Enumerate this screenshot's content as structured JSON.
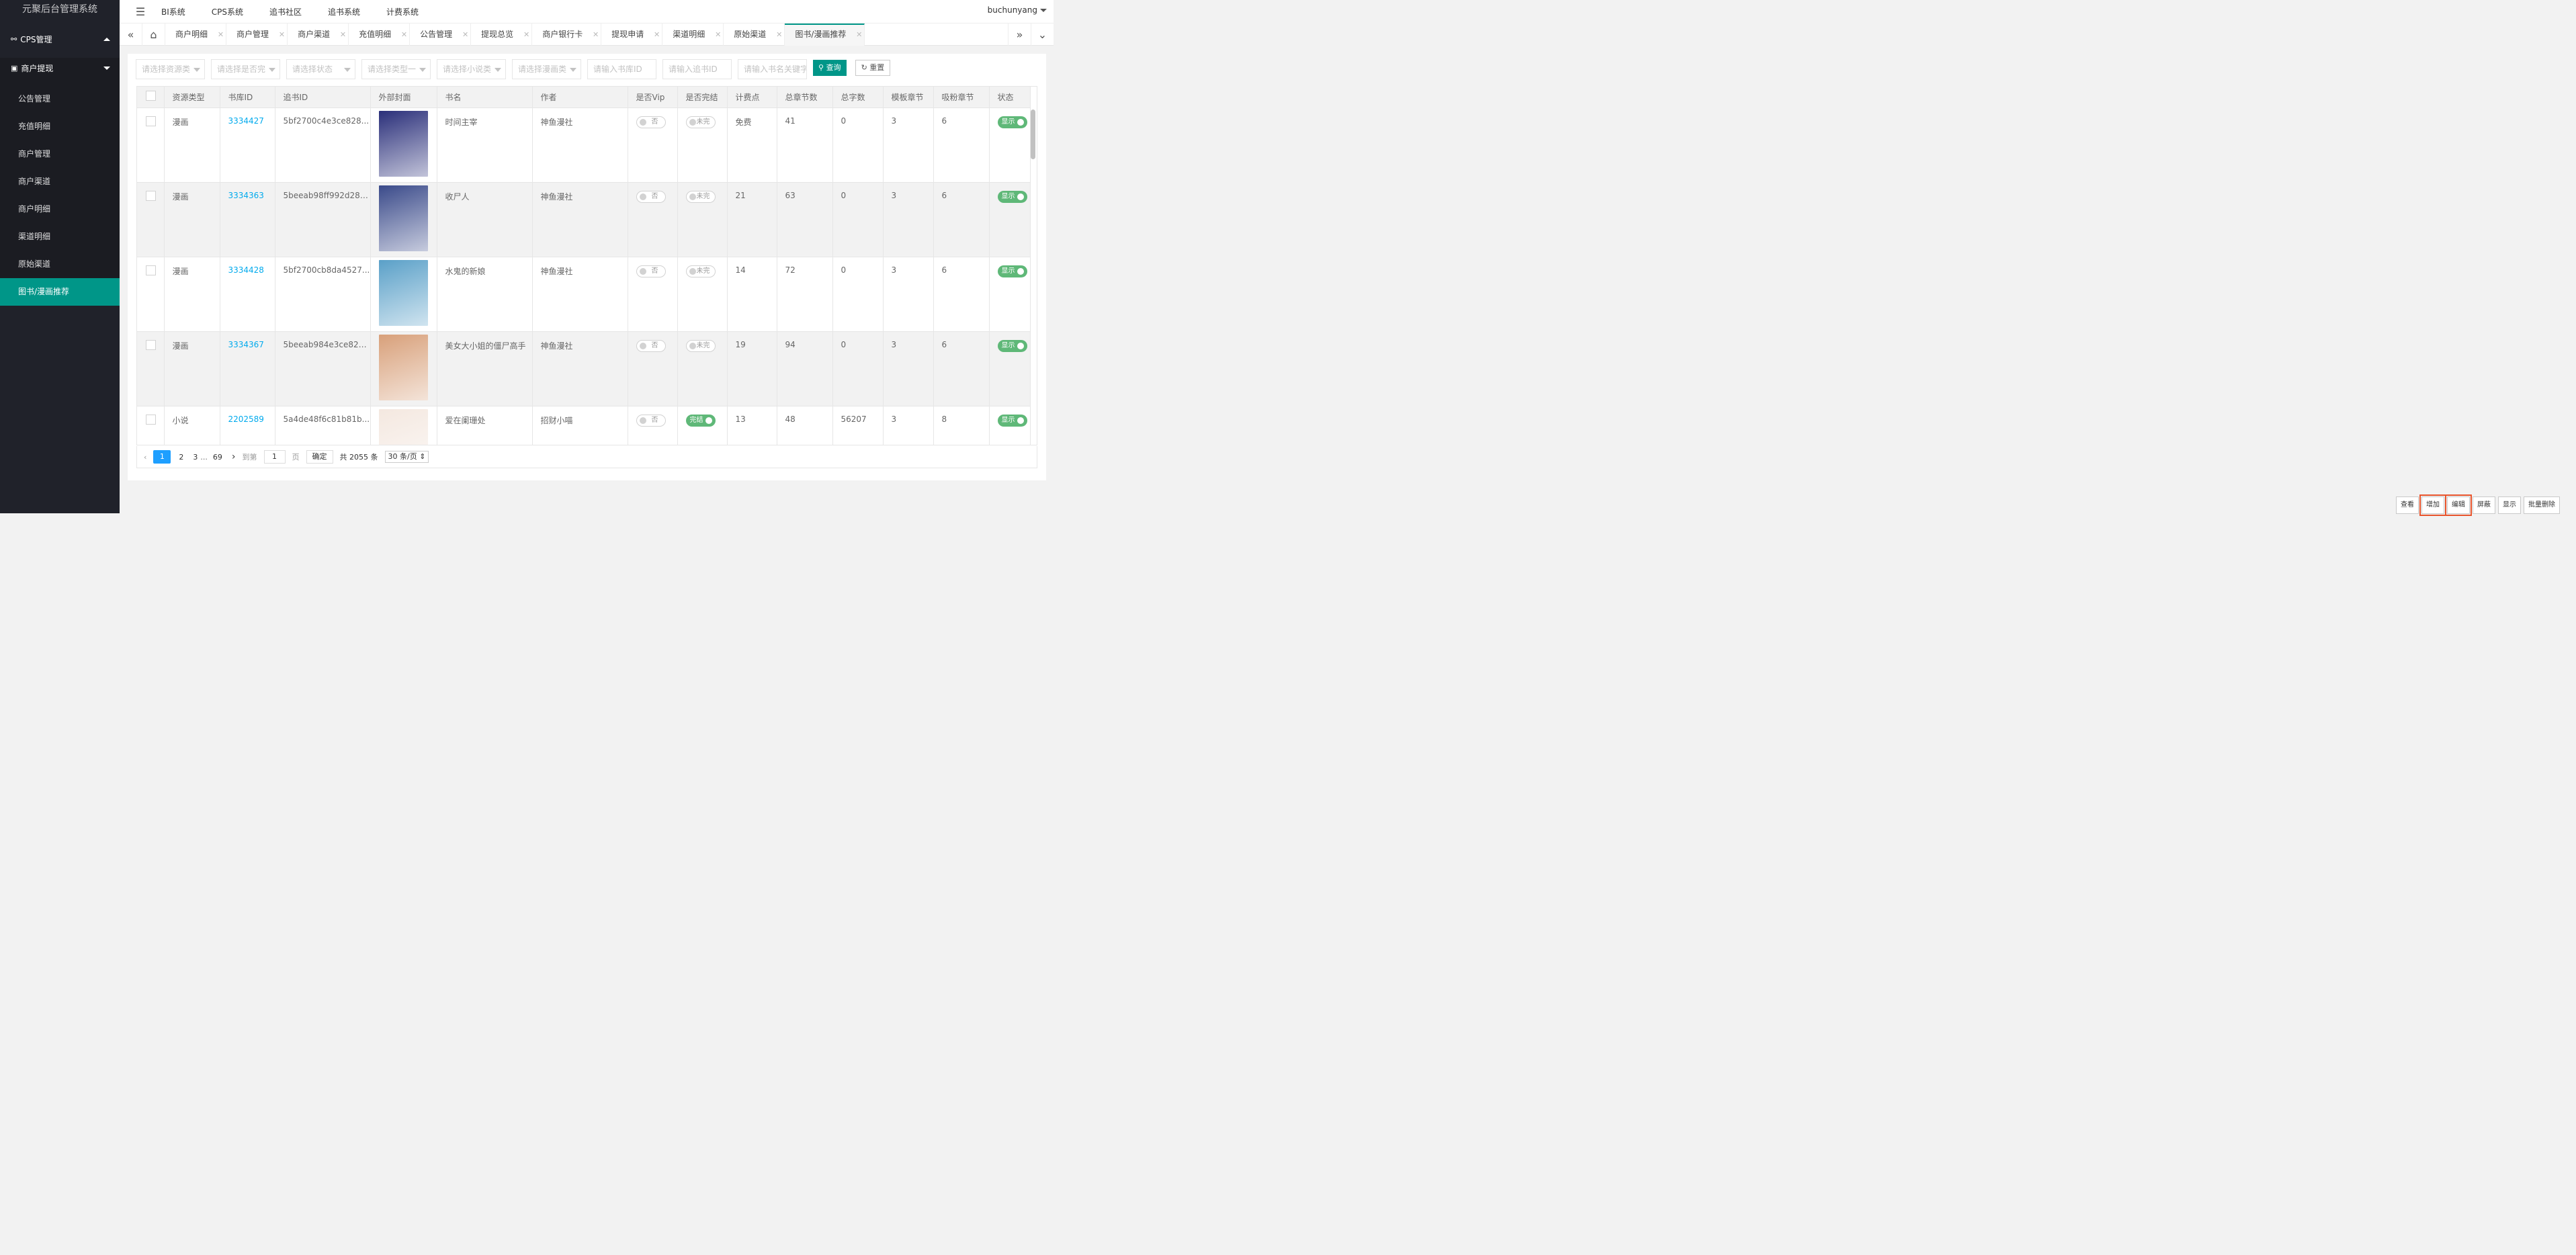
{
  "app_title": "元聚后台管理系统",
  "sidebar": {
    "group": "CPS管理",
    "sub": "商户提现",
    "items": [
      "公告管理",
      "充值明细",
      "商户管理",
      "商户渠道",
      "商户明细",
      "渠道明细",
      "原始渠道",
      "图书/漫画推荐"
    ]
  },
  "topnav": [
    "BI系统",
    "CPS系统",
    "追书社区",
    "追书系统",
    "计费系统"
  ],
  "user": "buchunyang",
  "tabs": [
    "商户明细",
    "商户管理",
    "商户渠道",
    "充值明细",
    "公告管理",
    "提现总览",
    "商户银行卡",
    "提现申请",
    "渠道明细",
    "原始渠道",
    "图书/漫画推荐"
  ],
  "filters": {
    "selects": [
      "请选择资源类",
      "请选择是否完",
      "请选择状态",
      "请选择类型一",
      "请选择小说类",
      "请选择漫画类"
    ],
    "inputs": [
      "请输入书库ID",
      "请输入追书ID",
      "请输入书名关键字"
    ],
    "query": "查询",
    "reset": "重置"
  },
  "columns": [
    "资源类型",
    "书库ID",
    "追书ID",
    "外部封面",
    "书名",
    "作者",
    "是否Vip",
    "是否完结",
    "计费点",
    "总章节数",
    "总字数",
    "模板章节",
    "吸粉章节",
    "状态"
  ],
  "rows": [
    {
      "type": "漫画",
      "lib_id": "3334427",
      "zs_id": "5bf2700c4e3ce828...",
      "title": "时间主宰",
      "author": "神鱼漫社",
      "vip": "否",
      "done": "未完",
      "done_on": false,
      "fee": "免费",
      "chapters": "41",
      "words": "0",
      "tpl": "3",
      "fans": "6",
      "status": "显示"
    },
    {
      "type": "漫画",
      "lib_id": "3334363",
      "zs_id": "5beeab98ff992d283...",
      "title": "收尸人",
      "author": "神鱼漫社",
      "vip": "否",
      "done": "未完",
      "done_on": false,
      "fee": "21",
      "chapters": "63",
      "words": "0",
      "tpl": "3",
      "fans": "6",
      "status": "显示"
    },
    {
      "type": "漫画",
      "lib_id": "3334428",
      "zs_id": "5bf2700cb8da4527...",
      "title": "水鬼的新娘",
      "author": "神鱼漫社",
      "vip": "否",
      "done": "未完",
      "done_on": false,
      "fee": "14",
      "chapters": "72",
      "words": "0",
      "tpl": "3",
      "fans": "6",
      "status": "显示"
    },
    {
      "type": "漫画",
      "lib_id": "3334367",
      "zs_id": "5beeab984e3ce828...",
      "title": "美女大小姐的僵尸高手",
      "author": "神鱼漫社",
      "vip": "否",
      "done": "未完",
      "done_on": false,
      "fee": "19",
      "chapters": "94",
      "words": "0",
      "tpl": "3",
      "fans": "6",
      "status": "显示"
    },
    {
      "type": "小说",
      "lib_id": "2202589",
      "zs_id": "5a4de48f6c81b81b...",
      "title": "爱在阑珊处",
      "author": "招财小喵",
      "vip": "否",
      "done": "完结",
      "done_on": true,
      "fee": "13",
      "chapters": "48",
      "words": "56207",
      "tpl": "3",
      "fans": "8",
      "status": "显示"
    }
  ],
  "covers": [
    "#2a2f7a",
    "#3a4a8a",
    "#5aa0c8",
    "#d8a07a",
    "#f4e8e0"
  ],
  "pager": {
    "pages": [
      "1",
      "2",
      "3",
      "...",
      "69"
    ],
    "goto": "到第",
    "page_input": "1",
    "page_unit": "页",
    "confirm": "确定",
    "total": "共 2055 条",
    "per_page": "30 条/页"
  },
  "actions": [
    "查看",
    "增加",
    "编辑",
    "屏蔽",
    "显示",
    "批量删除"
  ],
  "colors": {
    "accent": "#009688",
    "sidebar": "#20222a",
    "switch_on": "#5fb878",
    "link": "#01aaed",
    "highlight": "#e8542c"
  }
}
